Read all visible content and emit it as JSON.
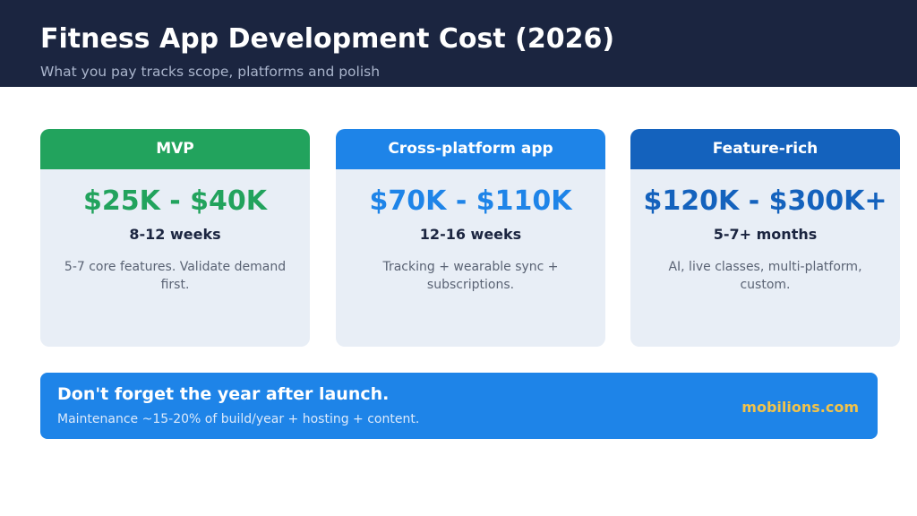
{
  "header": {
    "title": "Fitness App Development Cost (2026)",
    "subtitle": "What you pay tracks scope, platforms and polish"
  },
  "cards": [
    {
      "label": "MVP",
      "price": "$25K - $40K",
      "duration": "8-12 weeks",
      "description": "5-7 core features. Validate demand first.",
      "color": "#22a35d"
    },
    {
      "label": "Cross-platform app",
      "price": "$70K - $110K",
      "duration": "12-16 weeks",
      "description": "Tracking + wearable sync + subscriptions.",
      "color": "#1e84e8"
    },
    {
      "label": "Feature-rich",
      "price": "$120K - $300K+",
      "duration": "5-7+ months",
      "description": "AI, live classes, multi-platform, custom.",
      "color": "#1462bd"
    }
  ],
  "banner": {
    "title": "Don't forget the year after launch.",
    "subtitle": "Maintenance ~15-20% of build/year + hosting + content.",
    "brand": "mobilions.com"
  }
}
